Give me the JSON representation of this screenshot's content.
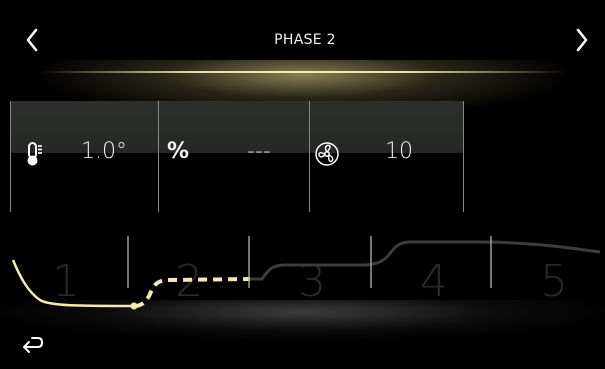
{
  "header": {
    "title": "PHASE 2",
    "prev_icon": "chevron-left-icon",
    "next_icon": "chevron-right-icon"
  },
  "params": [
    {
      "icon": "thermometer-icon",
      "value": "1.0°"
    },
    {
      "icon": "percent-icon",
      "label": "%",
      "value": "---"
    },
    {
      "icon": "fan-icon",
      "value": "10"
    }
  ],
  "phases": {
    "labels": [
      "1",
      "2",
      "3",
      "4",
      "5"
    ],
    "current": 2
  },
  "footer": {
    "back_icon": "return-arrow-icon"
  },
  "colors": {
    "accent": "#f3ecac",
    "bar": "#2b2d2b",
    "curve_inactive": "#3a3a3a",
    "divider": "#9a9a9a"
  }
}
